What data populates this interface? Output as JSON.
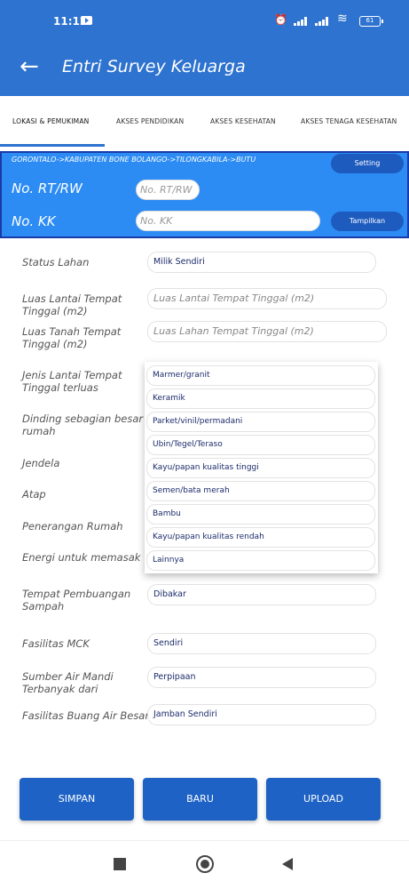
{
  "status_bar": {
    "time": "11:12",
    "battery": "61"
  },
  "app_bar": {
    "title": "Entri Survey Keluarga"
  },
  "tabs": [
    {
      "label": "LOKASI & PEMUKIMAN",
      "active": true
    },
    {
      "label": "AKSES PENDIDIKAN",
      "active": false
    },
    {
      "label": "AKSES KESEHATAN",
      "active": false
    },
    {
      "label": "AKSES TENAGA KESEHATAN",
      "active": false
    }
  ],
  "location": {
    "region": "GORONTALO->KABUPATEN BONE BOLANGO->TILONGKABILA->BUTU",
    "setting_button": "Setting",
    "rtrw_label": "No. RT/RW",
    "rtrw_placeholder": "No. RT/RW",
    "kk_label": "No. KK",
    "kk_placeholder": "No. KK",
    "show_button": "Tampilkan"
  },
  "form": {
    "status_lahan": {
      "label": "Status Lahan",
      "value": "Milik Sendiri"
    },
    "luas_lantai": {
      "label": "Luas Lantai Tempat Tinggal (m2)",
      "placeholder": "Luas Lantai Tempat Tinggal (m2)"
    },
    "luas_tanah": {
      "label": "Luas Tanah Tempat Tinggal (m2)",
      "placeholder": "Luas Lahan Tempat Tinggal (m2)"
    },
    "jenis_lantai": {
      "label": "Jenis Lantai Tempat Tinggal terluas"
    },
    "dinding": {
      "label": "Dinding sebagian besar rumah"
    },
    "jendela": {
      "label": "Jendela"
    },
    "atap": {
      "label": "Atap"
    },
    "penerangan": {
      "label": "Penerangan Rumah"
    },
    "energi": {
      "label": "Energi untuk memasak"
    },
    "pembuangan_sampah": {
      "label": "Tempat Pembuangan Sampah",
      "value": "Dibakar"
    },
    "fasilitas_mck": {
      "label": "Fasilitas MCK",
      "value": "Sendiri"
    },
    "sumber_air": {
      "label": "Sumber Air Mandi Terbanyak dari",
      "value": "Perpipaan"
    },
    "buang_air": {
      "label": "Fasilitas Buang Air Besar",
      "value": "Jamban Sendiri"
    }
  },
  "dropdown_options": [
    "Marmer/granit",
    "Keramik",
    "Parket/vinil/permadani",
    "Ubin/Tegel/Teraso",
    "Kayu/papan kualitas tinggi",
    "Semen/bata merah",
    "Bambu",
    "Kayu/papan kualitas rendah",
    "Lainnya"
  ],
  "buttons": {
    "save": "SIMPAN",
    "new": "BARU",
    "upload": "UPLOAD"
  },
  "colors": {
    "primary": "#2e73cf",
    "panel": "#2c8cf4",
    "button": "#1e62c5"
  }
}
